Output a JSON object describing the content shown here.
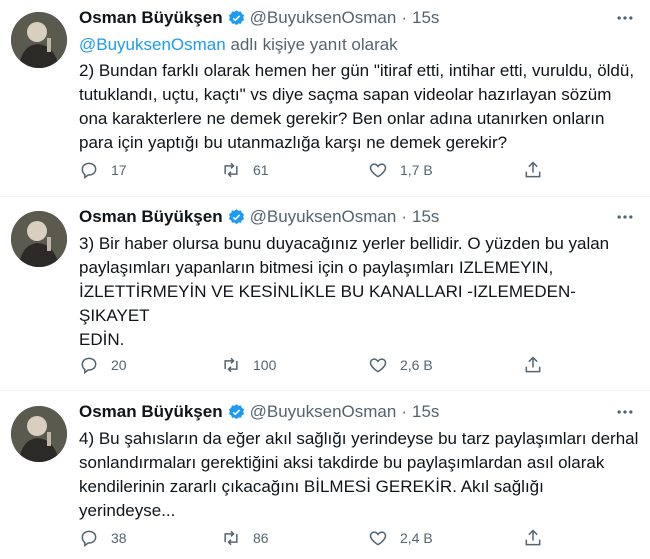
{
  "tweets": [
    {
      "author_name": "Osman Büyükşen",
      "handle": "@BuyuksenOsman",
      "separator": "·",
      "time": "15s",
      "reply_to_mention": "@BuyuksenOsman",
      "reply_to_suffix": " adlı kişiye yanıt olarak",
      "text": "2) Bundan farklı olarak hemen her gün \"itiraf etti, intihar etti, vuruldu, öldü, tutuklandı, uçtu, kaçtı\" vs diye saçma sapan videolar hazırlayan sözüm ona karakterlere ne demek gerekir? Ben onlar adına utanırken onların para için yaptığı bu utanmazlığa karşı ne demek gerekir?",
      "reply_count": "17",
      "retweet_count": "61",
      "like_count": "1,7 B"
    },
    {
      "author_name": "Osman Büyükşen",
      "handle": "@BuyuksenOsman",
      "separator": "·",
      "time": "15s",
      "text": "3) Bir haber olursa bunu duyacağınız yerler bellidir. O yüzden bu yalan paylaşımları yapanların bitmesi için o paylaşımları IZLEMEYIN, İZLETTİRMEYİN VE KESİNLİKLE BU KANALLARI -IZLEMEDEN-\nŞIKAYET\nEDİN.",
      "reply_count": "20",
      "retweet_count": "100",
      "like_count": "2,6 B"
    },
    {
      "author_name": "Osman Büyükşen",
      "handle": "@BuyuksenOsman",
      "separator": "·",
      "time": "15s",
      "text": "4) Bu şahısların da eğer akıl sağlığı yerindeyse bu tarz paylaşımları derhal sonlandırmaları gerektiğini aksi takdirde bu paylaşımlardan asıl olarak kendilerinin zararlı çıkacağını BİLMESİ GEREKİR. Akıl sağlığı yerindeyse...",
      "reply_count": "38",
      "retweet_count": "86",
      "like_count": "2,4 B"
    }
  ],
  "icons": {
    "verified": "verified-badge-icon",
    "more": "more-dots-icon",
    "reply": "reply-icon",
    "retweet": "retweet-icon",
    "like": "like-icon",
    "share": "share-icon"
  },
  "colors": {
    "text": "#0f1419",
    "secondary": "#536471",
    "accent": "#1d9bf0",
    "divider": "#eff3f4"
  }
}
